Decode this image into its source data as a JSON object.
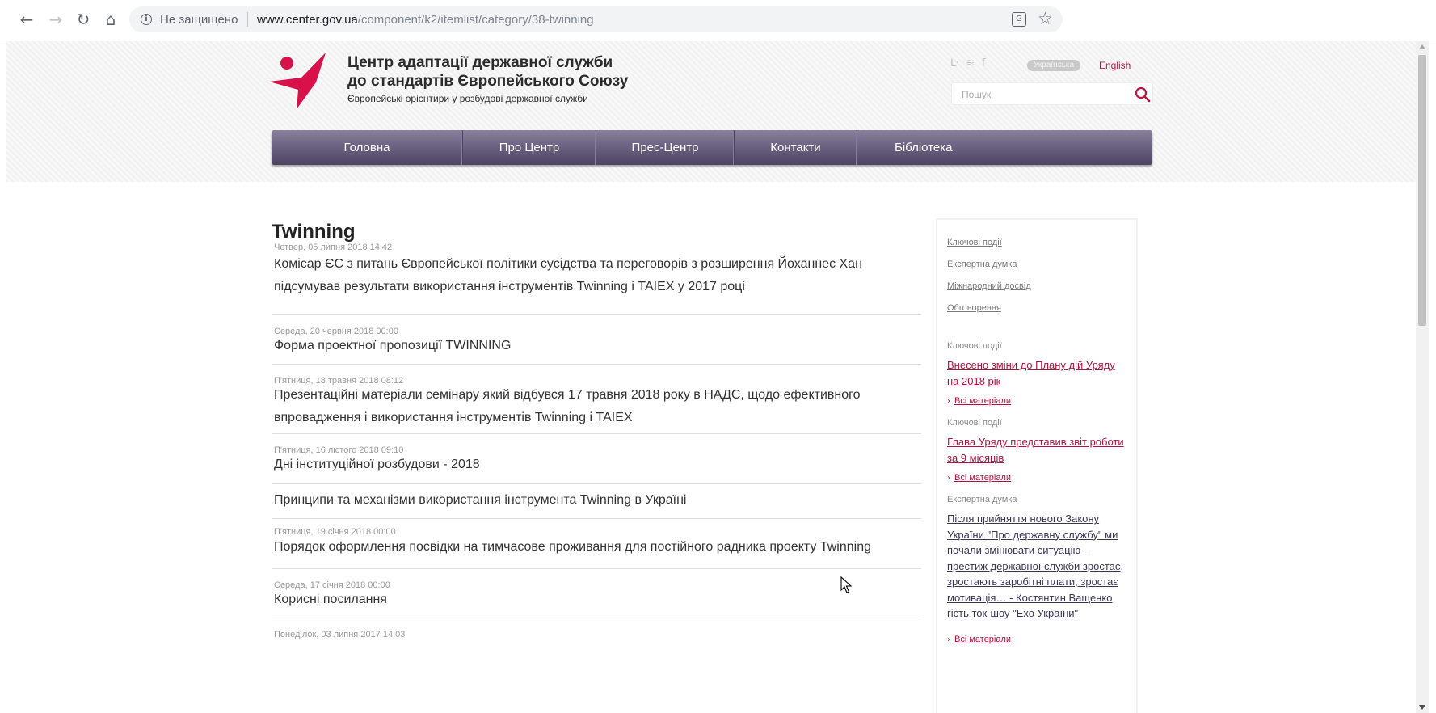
{
  "browser": {
    "security_text": "Не защищено",
    "url_host": "www.center.gov.ua",
    "url_path": "/component/k2/itemlist/category/38-twinning",
    "icons": [
      "back-icon",
      "forward-icon",
      "reload-icon",
      "home-icon",
      "info-icon",
      "translate-icon",
      "star-icon"
    ]
  },
  "header": {
    "title_line1": "Центр адаптації державної служби",
    "title_line2": "до стандартів Європейського Союзу",
    "tagline": "Європейські орієнтири у розбудові державної служби",
    "lang_active": "Українська",
    "lang_other": "English",
    "search_placeholder": "Пошук",
    "social_icons": [
      "twitter-icon",
      "rss-icon",
      "facebook-icon"
    ],
    "accent_color": "#c0123f",
    "menu_color": "#6c6383"
  },
  "menu": [
    {
      "label": "Головна"
    },
    {
      "label": "Про Центр"
    },
    {
      "label": "Прес-Центр"
    },
    {
      "label": "Контакти"
    },
    {
      "label": "Бібліотека"
    }
  ],
  "main": {
    "title": "Twinning",
    "articles": [
      {
        "date": "Четвер, 05 липня 2018 14:42",
        "title": "Комісар ЄС з питань Європейської політики сусідства та переговорів з розширення Йоханнес Хан підсумував результати використання інструментів Twinning і TAIEX у 2017 році"
      },
      {
        "date": "Середа, 20 червня 2018 00:00",
        "title": "Форма проектної пропозиції TWINNING"
      },
      {
        "date": "П'ятниця, 18 травня 2018 08:12",
        "title": "Презентаційні матеріали семінару який відбувся 17 травня 2018 року в НАДС, щодо ефективного впровадження і використання інструментів Twinning і TAIEX"
      },
      {
        "date": "П'ятниця, 16 лютого 2018 09:10",
        "title": "Дні інституційної розбудови - 2018"
      },
      {
        "date": "",
        "title": "Принципи та механізми використання інструмента Twinning в Україні"
      },
      {
        "date": "П'ятниця, 19 січня 2018 00:00",
        "title": "Порядок оформлення посвідки на тимчасове проживання для постійного радника проекту Twinning"
      },
      {
        "date": "Середа, 17 січня 2018 00:00",
        "title": "Корисні посилання"
      },
      {
        "date": "Понеділок, 03 липня 2017 14:03",
        "title": ""
      }
    ]
  },
  "sidebar": {
    "categories": [
      "Ключові події",
      "Експертна думка",
      "Міжнародний досвід",
      "Обговорення"
    ],
    "blocks": [
      {
        "label": "Ключові події",
        "link": "Внесено зміни до Плану дій Уряду на 2018 рік",
        "all": "Всі матеріали"
      },
      {
        "label": "Ключові події",
        "link": "Глава Уряду представив звіт роботи за 9 місяців",
        "all": "Всі матеріали"
      },
      {
        "label": "Експертна думка",
        "link": "Після прийняття нового Закону України \"Про державну службу\" ми почали змінювати ситуацію – престиж державної служби зростає, зростають заробітні плати, зростає мотивація… - Костянтин Ващенко гість ток-шоу \"Ехо України\"",
        "all": "Всі матеріали"
      }
    ]
  }
}
